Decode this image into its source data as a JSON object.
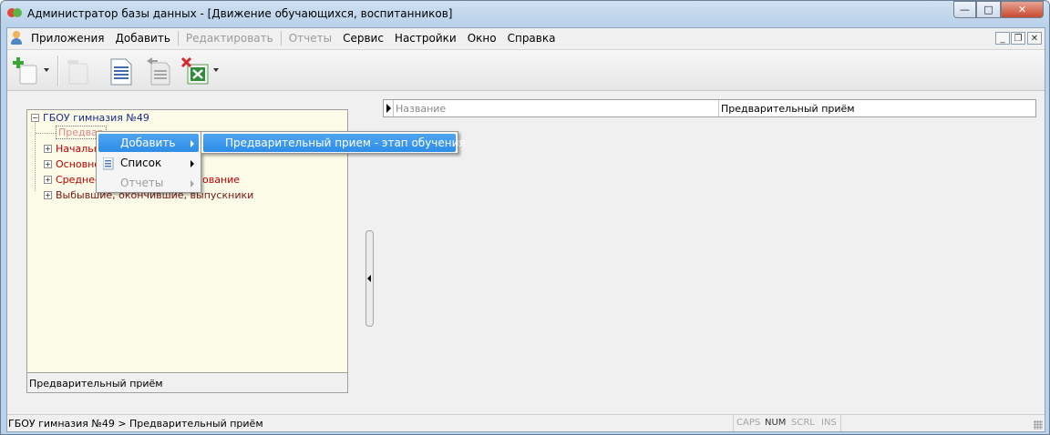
{
  "window": {
    "title": "Администратор базы данных - [Движение обучающихся, воспитанников]",
    "controls": {
      "minimize": "—",
      "maximize": "□",
      "close": "✕"
    }
  },
  "menu": {
    "items": [
      "Приложения",
      "Добавить",
      "Редактировать",
      "Отчеты",
      "Сервис",
      "Настройки",
      "Окно",
      "Справка"
    ],
    "disabled": [
      "Редактировать",
      "Отчеты"
    ],
    "mdi_controls": {
      "minimize": "_",
      "restore": "❐",
      "close": "✕"
    }
  },
  "toolbar": {
    "buttons": [
      "add-icon",
      "edit-icon",
      "list-icon",
      "import-icon",
      "excel-export-icon"
    ]
  },
  "tree": {
    "root": "ГБОУ гимназия №49",
    "items": [
      {
        "label": "Предварительный приём",
        "visible": "Предвар"
      },
      {
        "label": "Начальное общее образование",
        "visible": "Начальное"
      },
      {
        "label": "Основное общее образование",
        "visible": "Основное"
      },
      {
        "label": "Среднее (полное) общее образование",
        "visible_start": "Среднее",
        "visible_end": "ование"
      },
      {
        "label": "Выбывшие, окончившие, выпускники",
        "visible": "Выбывшие, окончившие, выпускники"
      }
    ],
    "footer": "Предварительный приём"
  },
  "context_menu": {
    "items": [
      {
        "label": "Добавить",
        "highlighted": true,
        "submenu": true
      },
      {
        "label": "Список",
        "submenu": true
      },
      {
        "label": "Отчеты",
        "disabled": true,
        "submenu": true
      }
    ],
    "submenu": {
      "label": "Предварительный прием - этап обучения"
    }
  },
  "grid": {
    "header_label": "Название",
    "value": "Предварительный приём"
  },
  "status": {
    "path": "ГБОУ гимназия №49 > Предварительный приём",
    "keys": [
      {
        "label": "CAPS",
        "on": false
      },
      {
        "label": "NUM",
        "on": true
      },
      {
        "label": "SCRL",
        "on": false
      },
      {
        "label": "INS",
        "on": false
      }
    ]
  },
  "colors": {
    "accent": "#3399ff",
    "tree_background": "#fbfbe7",
    "tree_red": "#c00000",
    "tree_root": "#1e2c8a"
  }
}
